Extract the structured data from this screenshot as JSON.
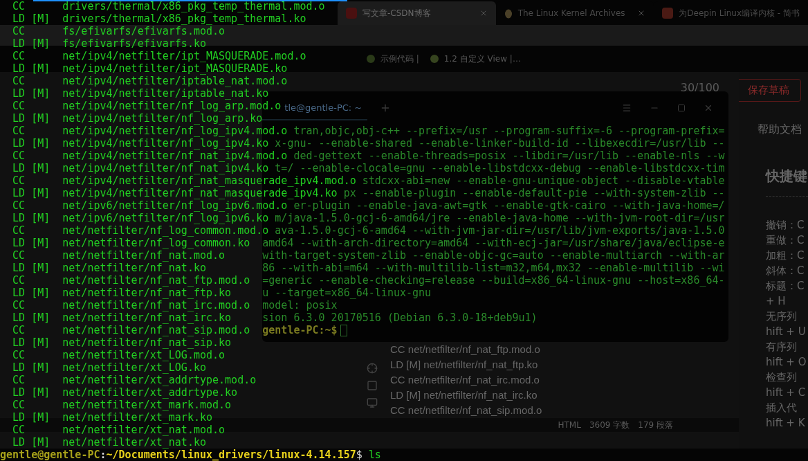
{
  "browser": {
    "tabs": [
      {
        "title": "写文章-CSDN博客",
        "selected": true
      },
      {
        "title": "The Linux Kernel Archives",
        "selected": false
      },
      {
        "title": "为Deepin Linux编译内核 - 简书",
        "selected": false
      }
    ],
    "bookmarks": [
      "示例代码 |",
      "1.2 自定义 View |…"
    ],
    "counter": "30/100",
    "save_button": "保存草稿",
    "editor_lines": [
      "CC net/netfilter/nf_nat_ftp.mod.o",
      "LD [M] net/netfilter/nf_nat_ftp.ko",
      "CC net/netfilter/nf_nat_irc.mod.o",
      "LD [M] net/netfilter/nf_nat_irc.ko",
      "CC net/netfilter/nf_nat_sip.mod.o"
    ],
    "status": [
      "HTML",
      "3609 字数",
      "179 段落"
    ],
    "help": {
      "tab": "帮助文档",
      "heading": "快捷键",
      "items": [
        "撤销：C",
        "重做：C",
        "加粗：C",
        "斜体：C",
        "标题：C",
        "+ H",
        "无序列",
        "hift + U",
        "有序列",
        "hift + O",
        "检查列",
        "hift + C",
        "插入代",
        "hift + K"
      ]
    }
  },
  "back_terminal": {
    "title": "tle@gentle-PC: ~",
    "lines": [
      "tran,objc,obj-c++ --prefix=/usr --program-suffix=-6 --program-prefix=",
      "x-gnu- --enable-shared --enable-linker-build-id --libexecdir=/usr/lib --",
      "ded-gettext --enable-threads=posix --libdir=/usr/lib --enable-nls --w",
      "t=/ --enable-clocale=gnu --enable-libstdcxx-debug --enable-libstdcxx-tim",
      "stdcxx-abi=new --enable-gnu-unique-object --disable-vtable",
      "px --enable-plugin --enable-default-pie --with-system-zlib --",
      "er-plugin --enable-java-awt=gtk --enable-gtk-cairo --with-java-home=/",
      "m/java-1.5.0-gcj-6-amd64/jre --enable-java-home --with-jvm-root-dir=/usr",
      "ava-1.5.0-gcj-6-amd64 --with-jvm-jar-dir=/usr/lib/jvm-exports/java-1.5.0",
      "amd64 --with-arch-directory=amd64 --with-ecj-jar=/usr/share/java/eclipse-e",
      "with-target-system-zlib --enable-objc-gc=auto --enable-multiarch --with-ar",
      "86 --with-abi=m64 --with-multilib-list=m32,m64,mx32 --enable-multilib --wi",
      "=generic --enable-checking=release --build=x86_64-linux-gnu --host=x86_64-",
      "u --target=x86_64-linux-gnu",
      "model: posix",
      "sion 6.3.0 20170516 (Debian 6.3.0-18+deb9u1)"
    ],
    "prompt": "gentle-PC:~$"
  },
  "terminal": {
    "lines": [
      {
        "prefix": "CC",
        "path": "drivers/thermal/x86_pkg_temp_thermal.mod.o"
      },
      {
        "prefix": "LD [M]",
        "path": "drivers/thermal/x86_pkg_temp_thermal.ko"
      },
      {
        "prefix": "CC",
        "path": "fs/efivarfs/efivarfs.mod.o"
      },
      {
        "prefix": "LD [M]",
        "path": "fs/efivarfs/efivarfs.ko"
      },
      {
        "prefix": "CC",
        "path": "net/ipv4/netfilter/ipt_MASQUERADE.mod.o"
      },
      {
        "prefix": "LD [M]",
        "path": "net/ipv4/netfilter/ipt_MASQUERADE.ko"
      },
      {
        "prefix": "CC",
        "path": "net/ipv4/netfilter/iptable_nat.mod.o"
      },
      {
        "prefix": "LD [M]",
        "path": "net/ipv4/netfilter/iptable_nat.ko"
      },
      {
        "prefix": "CC",
        "path": "net/ipv4/netfilter/nf_log_arp.mod.o"
      },
      {
        "prefix": "LD [M]",
        "path": "net/ipv4/netfilter/nf_log_arp.ko"
      },
      {
        "prefix": "CC",
        "path": "net/ipv4/netfilter/nf_log_ipv4.mod.o"
      },
      {
        "prefix": "LD [M]",
        "path": "net/ipv4/netfilter/nf_log_ipv4.ko"
      },
      {
        "prefix": "CC",
        "path": "net/ipv4/netfilter/nf_nat_ipv4.mod.o"
      },
      {
        "prefix": "LD [M]",
        "path": "net/ipv4/netfilter/nf_nat_ipv4.ko"
      },
      {
        "prefix": "CC",
        "path": "net/ipv4/netfilter/nf_nat_masquerade_ipv4.mod.o"
      },
      {
        "prefix": "LD [M]",
        "path": "net/ipv4/netfilter/nf_nat_masquerade_ipv4.ko"
      },
      {
        "prefix": "CC",
        "path": "net/ipv6/netfilter/nf_log_ipv6.mod.o"
      },
      {
        "prefix": "LD [M]",
        "path": "net/ipv6/netfilter/nf_log_ipv6.ko"
      },
      {
        "prefix": "CC",
        "path": "net/netfilter/nf_log_common.mod.o"
      },
      {
        "prefix": "LD [M]",
        "path": "net/netfilter/nf_log_common.ko"
      },
      {
        "prefix": "CC",
        "path": "net/netfilter/nf_nat.mod.o"
      },
      {
        "prefix": "LD [M]",
        "path": "net/netfilter/nf_nat.ko"
      },
      {
        "prefix": "CC",
        "path": "net/netfilter/nf_nat_ftp.mod.o"
      },
      {
        "prefix": "LD [M]",
        "path": "net/netfilter/nf_nat_ftp.ko"
      },
      {
        "prefix": "CC",
        "path": "net/netfilter/nf_nat_irc.mod.o"
      },
      {
        "prefix": "LD [M]",
        "path": "net/netfilter/nf_nat_irc.ko"
      },
      {
        "prefix": "CC",
        "path": "net/netfilter/nf_nat_sip.mod.o"
      },
      {
        "prefix": "LD [M]",
        "path": "net/netfilter/nf_nat_sip.ko"
      },
      {
        "prefix": "CC",
        "path": "net/netfilter/xt_LOG.mod.o"
      },
      {
        "prefix": "LD [M]",
        "path": "net/netfilter/xt_LOG.ko"
      },
      {
        "prefix": "CC",
        "path": "net/netfilter/xt_addrtype.mod.o"
      },
      {
        "prefix": "LD [M]",
        "path": "net/netfilter/xt_addrtype.ko"
      },
      {
        "prefix": "CC",
        "path": "net/netfilter/xt_mark.mod.o"
      },
      {
        "prefix": "LD [M]",
        "path": "net/netfilter/xt_mark.ko"
      },
      {
        "prefix": "CC",
        "path": "net/netfilter/xt_nat.mod.o"
      },
      {
        "prefix": "LD [M]",
        "path": "net/netfilter/xt_nat.ko"
      }
    ],
    "prompt": {
      "user": "gentle@gentle-PC",
      "separator": ":",
      "path": "~/Documents/linux_drivers/linux-4.14.157",
      "symbol": "$",
      "command": "ls"
    }
  }
}
